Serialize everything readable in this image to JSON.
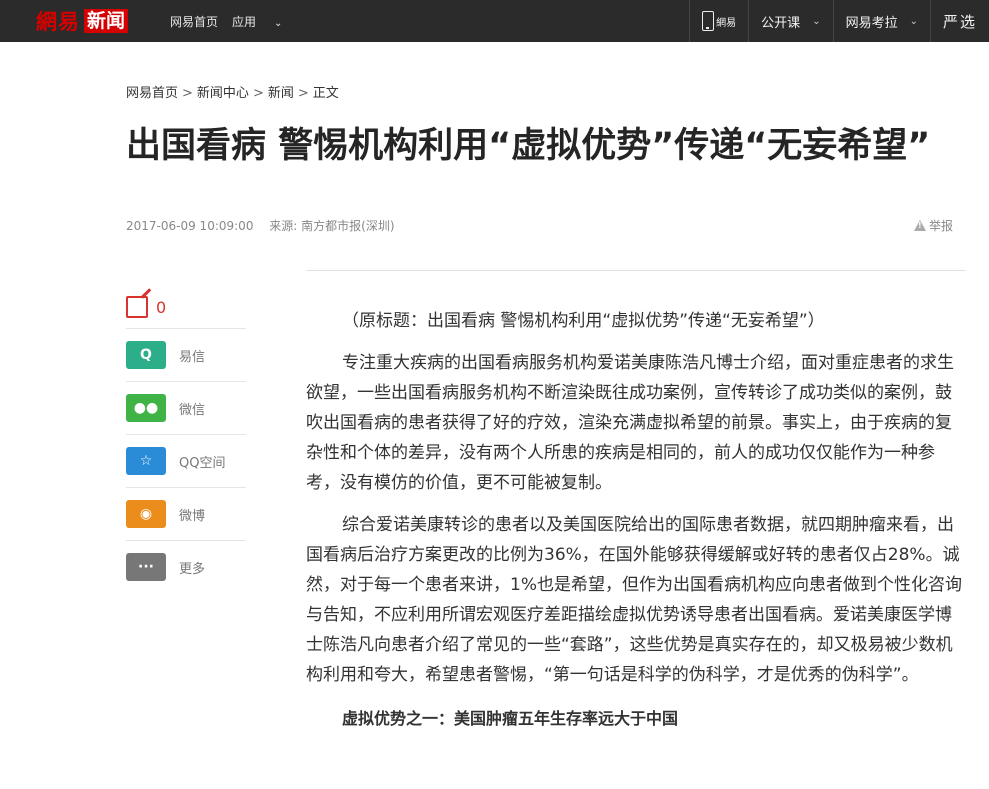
{
  "topbar": {
    "logo_wangyi": "網易",
    "logo_xinwen": "新闻",
    "home": "网易首页",
    "apps": "应用",
    "mobile_label": "網易",
    "open_course": "公开课",
    "kaola": "网易考拉",
    "yanxuan": "严选"
  },
  "breadcrumb": [
    "网易首页",
    "新闻中心",
    "新闻",
    "正文"
  ],
  "article": {
    "title": "出国看病 警惕机构利用“虚拟优势”传递“无妄希望”",
    "date": "2017-06-09 10:09:00",
    "source": "来源: 南方都市报(深圳)",
    "report": "举报",
    "paragraphs": [
      "（原标题：出国看病 警惕机构利用“虚拟优势”传递“无妄希望”）",
      "专注重大疾病的出国看病服务机构爱诺美康陈浩凡博士介绍，面对重症患者的求生欲望，一些出国看病服务机构不断渲染既往成功案例，宣传转诊了成功类似的案例，鼓吹出国看病的患者获得了好的疗效，渲染充满虚拟希望的前景。事实上，由于疾病的复杂性和个体的差异，没有两个人所患的疾病是相同的，前人的成功仅仅能作为一种参考，没有模仿的价值，更不可能被复制。",
      "综合爱诺美康转诊的患者以及美国医院给出的国际患者数据，就四期肿瘤来看，出国看病后治疗方案更改的比例为36%，在国外能够获得缓解或好转的患者仅占28%。诚然，对于每一个患者来讲，1%也是希望，但作为出国看病机构应向患者做到个性化咨询与告知，不应利用所谓宏观医疗差距描绘虚拟优势诱导患者出国看病。爱诺美康医学博士陈浩凡向患者介绍了常见的一些“套路”，这些优势是真实存在的，却又极易被少数机构利用和夸大，希望患者警惕，“第一句话是科学的伪科学，才是优秀的伪科学”。"
    ],
    "subheading": "虚拟优势之一：美国肿瘤五年生存率远大于中国"
  },
  "share": {
    "comment_count": "0",
    "items": [
      {
        "label": "易信",
        "icon": "yixin-icon",
        "glyph": "Q"
      },
      {
        "label": "微信",
        "icon": "wechat-icon",
        "glyph": "●●"
      },
      {
        "label": "QQ空间",
        "icon": "qzone-icon",
        "glyph": "☆"
      },
      {
        "label": "微博",
        "icon": "weibo-icon",
        "glyph": "◉"
      },
      {
        "label": "更多",
        "icon": "more-icon",
        "glyph": "···"
      }
    ]
  }
}
